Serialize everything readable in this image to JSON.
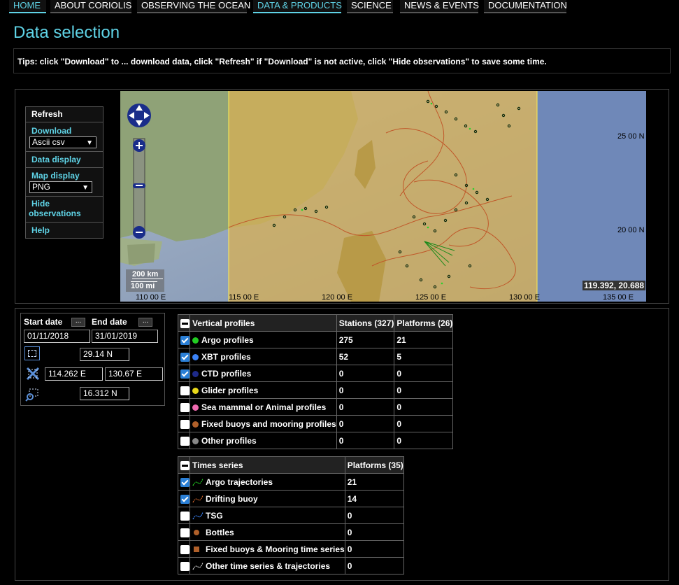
{
  "nav": [
    "HOME",
    "ABOUT CORIOLIS",
    "OBSERVING THE OCEAN",
    "DATA & PRODUCTS",
    "SCIENCE",
    "NEWS & EVENTS",
    "DOCUMENTATION"
  ],
  "title": "Data selection",
  "tips": "Tips: click \"Download\" to ... download data, click \"Refresh\" if \"Download\" is not active, click \"Hide observations\" to save some time.",
  "menu": {
    "refresh": "Refresh",
    "download": "Download",
    "download_format": "Ascii csv",
    "data_display": "Data display",
    "map_display": "Map display",
    "map_format": "PNG",
    "hide1": "Hide",
    "hide2": "observations",
    "help": "Help"
  },
  "map": {
    "scale_km": "200 km",
    "scale_mi": "100 mi",
    "lon": [
      "110 00 E",
      "115 00 E",
      "120 00 E",
      "125 00 E",
      "130 00 E",
      "135 00 E"
    ],
    "lat": [
      "25 00 N",
      "20 00 N"
    ],
    "cursor": "119.392, 20.688"
  },
  "dates": {
    "start_label": "Start date",
    "end_label": "End date",
    "btn": "...",
    "start": "01/11/2018",
    "end": "31/01/2019",
    "north": "29.14 N",
    "west": "114.262 E",
    "east": "130.67 E",
    "south": "16.312 N"
  },
  "vp": {
    "header": "Vertical profiles",
    "stations_hdr": "Stations (327)",
    "platforms_hdr": "Platforms (26)",
    "rows": [
      {
        "label": "Argo profiles",
        "stations": "275",
        "platforms": "21",
        "checked": true,
        "color": "#22cc22"
      },
      {
        "label": "XBT profiles",
        "stations": "52",
        "platforms": "5",
        "checked": true,
        "color": "#3b82f6"
      },
      {
        "label": "CTD profiles",
        "stations": "0",
        "platforms": "0",
        "checked": true,
        "color": "#1e2a8a"
      },
      {
        "label": "Glider profiles",
        "stations": "0",
        "platforms": "0",
        "checked": false,
        "color": "#e8d81a"
      },
      {
        "label": "Sea mammal or Animal profiles",
        "stations": "0",
        "platforms": "0",
        "checked": false,
        "color": "#f06ab0"
      },
      {
        "label": "Fixed buoys and mooring profiles",
        "stations": "0",
        "platforms": "0",
        "checked": false,
        "color": "#b0602a"
      },
      {
        "label": "Other profiles",
        "stations": "0",
        "platforms": "0",
        "checked": false,
        "color": "#888888"
      }
    ]
  },
  "ts": {
    "header": "Times series",
    "platforms_hdr": "Platforms (35)",
    "rows": [
      {
        "label": "Argo trajectories",
        "platforms": "21",
        "checked": true,
        "icon": "argo-trajectory-icon",
        "color": "#22cc22"
      },
      {
        "label": "Drifting buoy",
        "platforms": "14",
        "checked": true,
        "icon": "drifting-buoy-icon",
        "color": "#c8622a"
      },
      {
        "label": "TSG",
        "platforms": "0",
        "checked": false,
        "icon": "tsg-icon",
        "color": "#3b82f6"
      },
      {
        "label": "Bottles",
        "platforms": "0",
        "checked": false,
        "icon": "bottle-icon",
        "color": "#b0602a"
      },
      {
        "label": "Fixed buoys & Mooring time series",
        "platforms": "0",
        "checked": false,
        "icon": "mooring-icon",
        "color": "#b0602a"
      },
      {
        "label": "Other time series & trajectories",
        "platforms": "0",
        "checked": false,
        "icon": "other-trajectory-icon",
        "color": "#cccccc"
      }
    ]
  }
}
